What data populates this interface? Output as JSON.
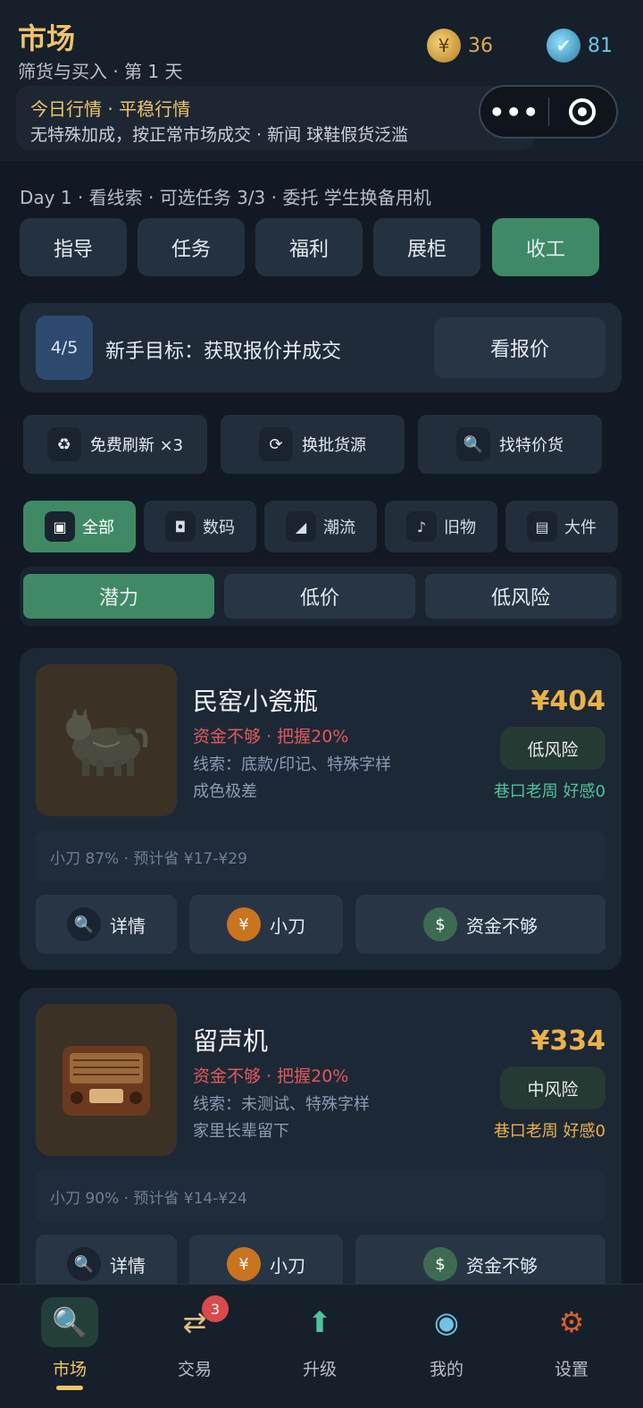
{
  "header": {
    "title": "市场",
    "subtitle": "筛货与买入 · 第 1 天",
    "gold": "36",
    "gems": "81",
    "banner_title": "今日行情 · 平稳行情",
    "banner_sub": "无特殊加成，按正常市场成交 · 新闻 球鞋假货泛滥"
  },
  "dayline": "Day 1 · 看线索 · 可选任务 3/3 · 委托 学生换备用机",
  "top_buttons": [
    "指导",
    "任务",
    "福利",
    "展柜",
    "收工"
  ],
  "goal": {
    "progress": "4/5",
    "text": "新手目标：获取报价并成交",
    "button": "看报价"
  },
  "actions": [
    "免费刷新 ×3",
    "换批货源",
    "找特价货"
  ],
  "categories": [
    "全部",
    "数码",
    "潮流",
    "旧物",
    "大件"
  ],
  "sorts": [
    "潜力",
    "低价",
    "低风险"
  ],
  "products": [
    {
      "name": "民窑小瓷瓶",
      "warn": "资金不够 · 把握20%",
      "clue": "线索：底款/印记、特殊字样",
      "desc": "成色极差",
      "price": "¥404",
      "risk": "低风险",
      "vendor": "巷口老周 好感0",
      "vendor_color": "#4fc39a",
      "info": "小刀 87% · 预计省 ¥17-¥29",
      "btn_detail": "详情",
      "btn_haggle": "小刀",
      "btn_buy": "资金不够"
    },
    {
      "name": "留声机",
      "warn": "资金不够 · 把握20%",
      "clue": "线索：未测试、特殊字样",
      "desc": "家里长辈留下",
      "price": "¥334",
      "risk": "中风险",
      "vendor": "巷口老周 好感0",
      "vendor_color": "#e9b24a",
      "info": "小刀 90% · 预计省 ¥14-¥24",
      "btn_detail": "详情",
      "btn_haggle": "小刀",
      "btn_buy": "资金不够"
    }
  ],
  "nav": {
    "items": [
      "市场",
      "交易",
      "升级",
      "我的",
      "设置"
    ],
    "trade_badge": "3"
  },
  "colors": {
    "accent_green": "#3f8a64",
    "gold_text": "#f0c46a",
    "warn_red": "#e05a5a"
  }
}
